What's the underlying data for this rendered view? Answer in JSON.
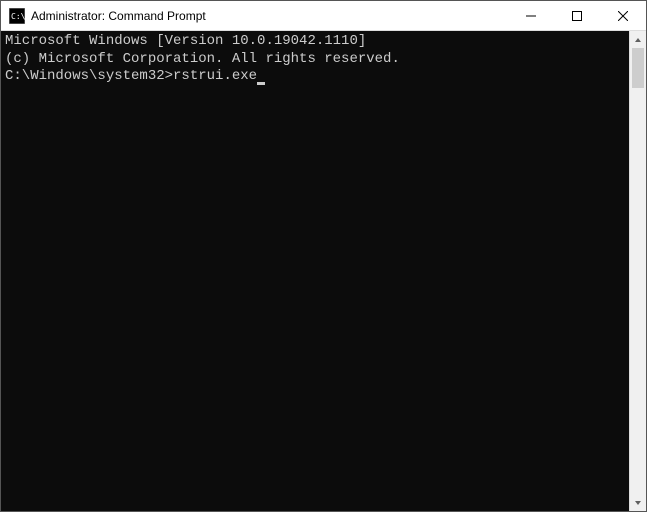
{
  "titlebar": {
    "title": "Administrator: Command Prompt"
  },
  "terminal": {
    "line1": "Microsoft Windows [Version 10.0.19042.1110]",
    "line2": "(c) Microsoft Corporation. All rights reserved.",
    "blank": "",
    "prompt": "C:\\Windows\\system32>",
    "command": "rstrui.exe"
  }
}
